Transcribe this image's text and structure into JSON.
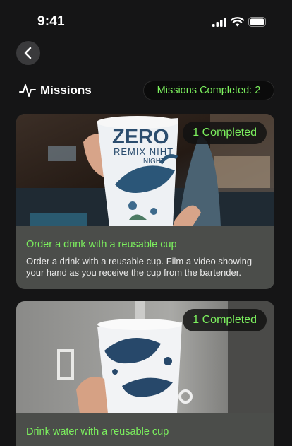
{
  "status_bar": {
    "time": "9:41"
  },
  "header": {
    "title": "Missions",
    "completed_label": "Missions Completed: 2"
  },
  "missions": [
    {
      "badge": "1 Completed",
      "title": "Order a drink with a reusable cup",
      "description": "Order a drink with a reusable cup. Film a video showing your hand as you receive the cup from the bartender.",
      "cup_text_line1": "ZERO",
      "cup_text_line2": "REMIX NIHT",
      "cup_text_line3": "NIGHT"
    },
    {
      "badge": "1 Completed",
      "title": "Drink water with a reusable cup"
    }
  ],
  "icons": {
    "back": "chevron-left-icon",
    "missions": "pulse-icon"
  },
  "colors": {
    "accent": "#7cf05e",
    "background": "#151516",
    "card": "#4b4d4a"
  }
}
